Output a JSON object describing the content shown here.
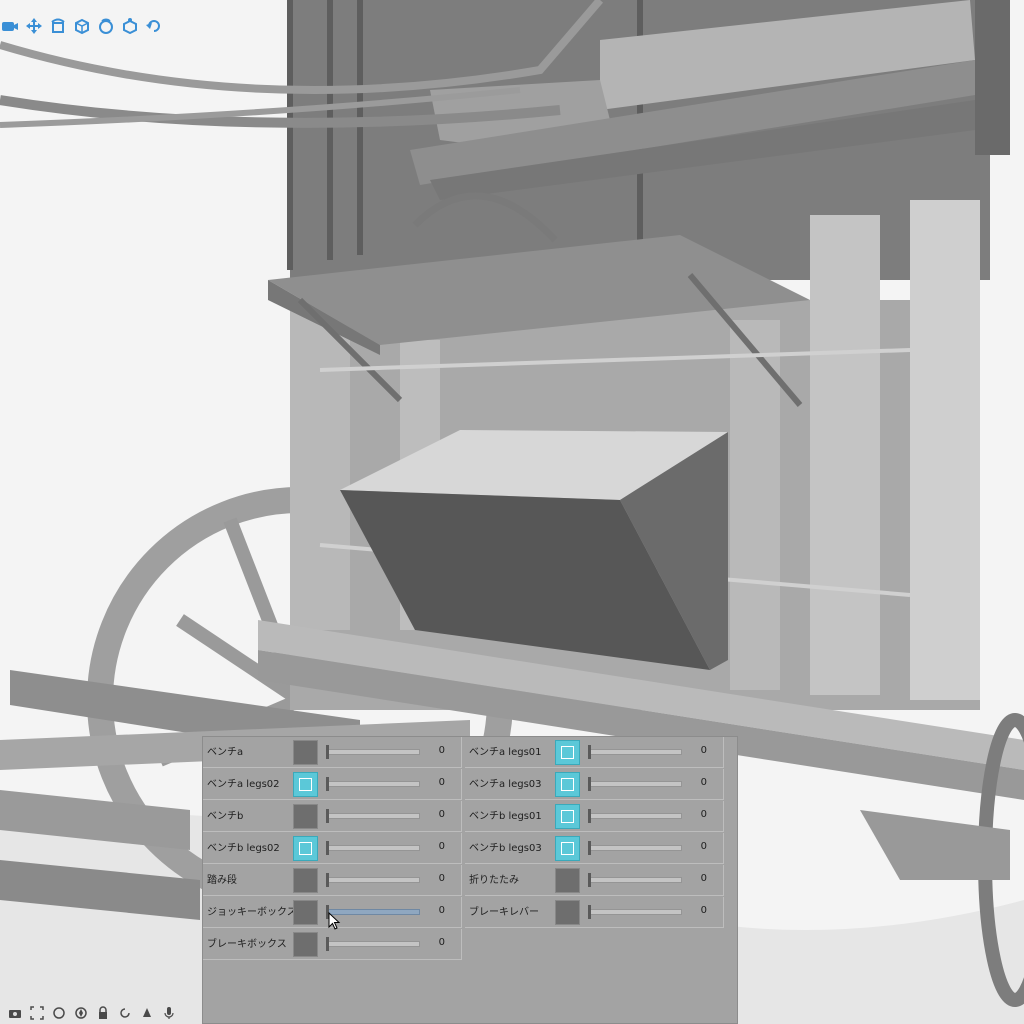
{
  "morph_panel": {
    "rows": [
      {
        "label": "ベンチa",
        "value": "0",
        "thumb": "image"
      },
      {
        "label": "ベンチa legs01",
        "value": "0",
        "thumb": "no-image"
      },
      {
        "label": "ベンチa legs02",
        "value": "0",
        "thumb": "no-image"
      },
      {
        "label": "ベンチa legs03",
        "value": "0",
        "thumb": "no-image"
      },
      {
        "label": "ベンチb",
        "value": "0",
        "thumb": "image"
      },
      {
        "label": "ベンチb legs01",
        "value": "0",
        "thumb": "no-image"
      },
      {
        "label": "ベンチb legs02",
        "value": "0",
        "thumb": "no-image"
      },
      {
        "label": "ベンチb legs03",
        "value": "0",
        "thumb": "no-image"
      },
      {
        "label": "踏み段",
        "value": "0",
        "thumb": "image"
      },
      {
        "label": "折りたたみ",
        "value": "0",
        "thumb": "image"
      },
      {
        "label": "ジョッキーボックス",
        "value": "0",
        "thumb": "image",
        "selected": true
      },
      {
        "label": "ブレーキレバー",
        "value": "0",
        "thumb": "image"
      },
      {
        "label": "ブレーキボックス",
        "value": "0",
        "thumb": "image"
      }
    ]
  },
  "toolbar": {
    "icons": [
      "camera-icon",
      "move-icon",
      "rotate-object-icon",
      "scale-object-icon",
      "bake-icon",
      "undo-icon"
    ]
  },
  "bottom_toolbar": {
    "icons": [
      "camera-capture-icon",
      "frame-icon",
      "camera-icon",
      "compass-icon",
      "lock-icon",
      "refresh-icon",
      "light-icon",
      "mic-icon"
    ]
  },
  "colors": {
    "panel_bg": "#a3a3a3",
    "toolbar_icon": "#3a8fd6",
    "no_image_thumb": "#5bc8d8"
  }
}
